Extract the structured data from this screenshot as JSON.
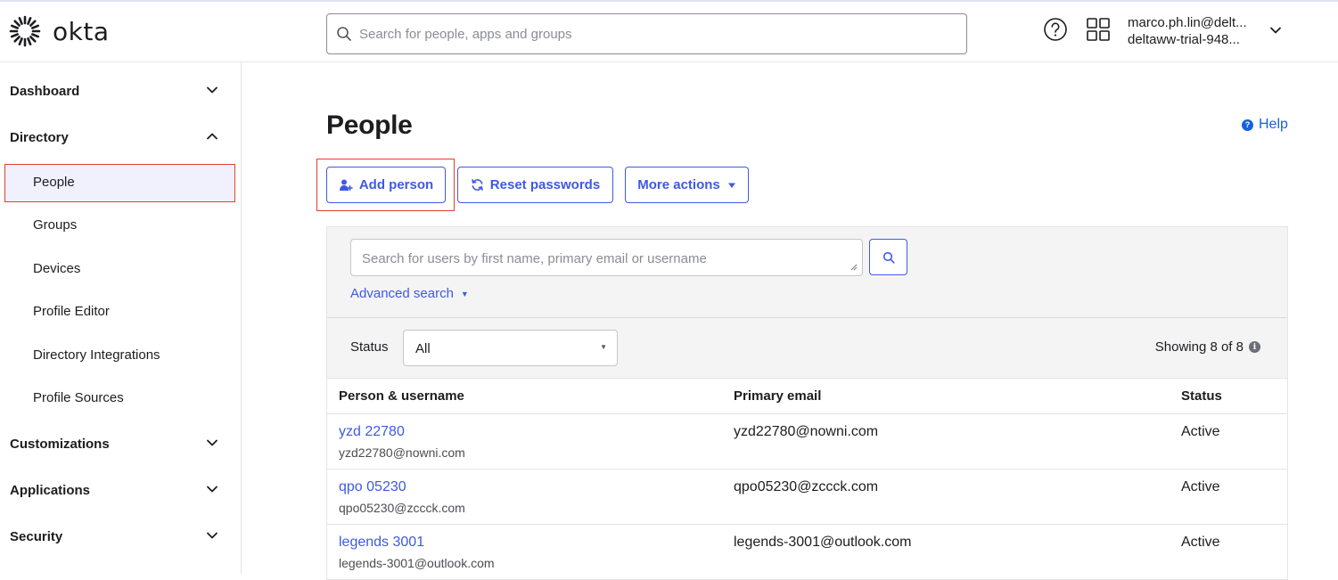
{
  "brand": {
    "name": "okta"
  },
  "header": {
    "search_placeholder": "Search for people, apps and groups",
    "user_email": "marco.ph.lin@delt...",
    "org_name": "deltaww-trial-948..."
  },
  "sidebar": {
    "sections": [
      {
        "label": "Dashboard",
        "expanded": false
      },
      {
        "label": "Directory",
        "expanded": true,
        "items": [
          {
            "label": "People",
            "active": true
          },
          {
            "label": "Groups"
          },
          {
            "label": "Devices"
          },
          {
            "label": "Profile Editor"
          },
          {
            "label": "Directory Integrations"
          },
          {
            "label": "Profile Sources"
          }
        ]
      },
      {
        "label": "Customizations",
        "expanded": false
      },
      {
        "label": "Applications",
        "expanded": false
      },
      {
        "label": "Security",
        "expanded": false
      }
    ]
  },
  "page": {
    "title": "People",
    "help_label": "Help",
    "actions": {
      "add_person": "Add person",
      "reset_passwords": "Reset passwords",
      "more_actions": "More actions"
    },
    "filter": {
      "search_placeholder": "Search for users by first name, primary email or username",
      "advanced_search": "Advanced search",
      "status_label": "Status",
      "status_value": "All",
      "showing": "Showing 8 of 8"
    },
    "table": {
      "headers": {
        "person": "Person & username",
        "email": "Primary email",
        "status": "Status"
      },
      "rows": [
        {
          "name": "yzd 22780",
          "username": "yzd22780@nowni.com",
          "email": "yzd22780@nowni.com",
          "status": "Active"
        },
        {
          "name": "qpo 05230",
          "username": "qpo05230@zccck.com",
          "email": "qpo05230@zccck.com",
          "status": "Active"
        },
        {
          "name": "legends 3001",
          "username": "legends-3001@outlook.com",
          "email": "legends-3001@outlook.com",
          "status": "Active"
        }
      ]
    }
  },
  "colors": {
    "accent": "#3f59e4",
    "highlight": "#e0402f",
    "help": "#1662dd"
  }
}
